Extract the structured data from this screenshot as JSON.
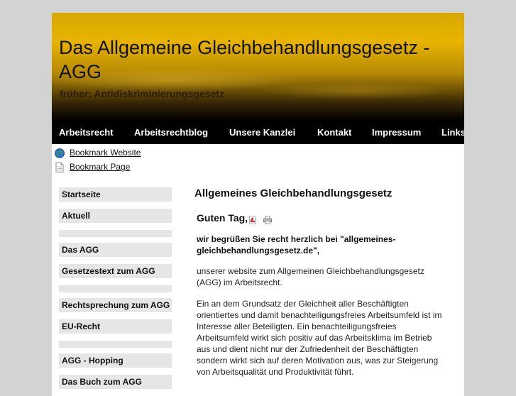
{
  "header": {
    "title": "Das Allgemeine Gleichbehandlungsgesetz - AGG",
    "subtitle": "früher: Antidiskriminierungsgesetz"
  },
  "nav": {
    "items": [
      "Arbeitsrecht",
      "Arbeitsrechtblog",
      "Unsere Kanzlei",
      "Kontakt",
      "Impressum",
      "Links"
    ]
  },
  "bookmarks": {
    "website": "Bookmark Website",
    "page": "Bookmark Page"
  },
  "sidebar": {
    "items": [
      "Startseite",
      "Aktuell",
      "",
      "Das AGG",
      "Gesetzestext zum AGG",
      "",
      "Rechtsprechung zum AGG",
      "EU-Recht",
      "",
      "AGG - Hopping",
      "Das Buch zum AGG"
    ]
  },
  "content": {
    "heading": "Allgemeines Gleichbehandlungsgesetz",
    "greeting": "Guten Tag,",
    "welcome": "wir begrüßen Sie recht herzlich bei \"allgemeines-gleichbehandlungsgesetz.de\",",
    "para1": "unserer website zum Allgemeinen Gleichbehandlungsgesetz (AGG) im Arbeitsrecht.",
    "para2": "Ein an dem Grundsatz der Gleichheit aller Beschäftigten orientiertes und damit benachteiligungsfreies Arbeitsumfeld ist im Interesse aller Beteiligten. Ein benachteiligungsfreies Arbeitsumfeld wirkt sich positiv auf das Arbeitsklima im Betrieb aus und dient nicht nur der Zufriedenheit der Beschäftigten sondern wirkt sich auf deren Motivation aus, was zur Steigerung von Arbeitsqualität und Produktivität  führt."
  },
  "icons": {
    "pdf": "pdf-icon",
    "print": "print-icon",
    "globe": "globe-icon",
    "page": "page-icon"
  },
  "colors": {
    "header_gold": "#e8b400",
    "nav_bg": "#000000",
    "sidebar_bg": "#e6e6e6",
    "page_bg": "#d3d3d3"
  }
}
